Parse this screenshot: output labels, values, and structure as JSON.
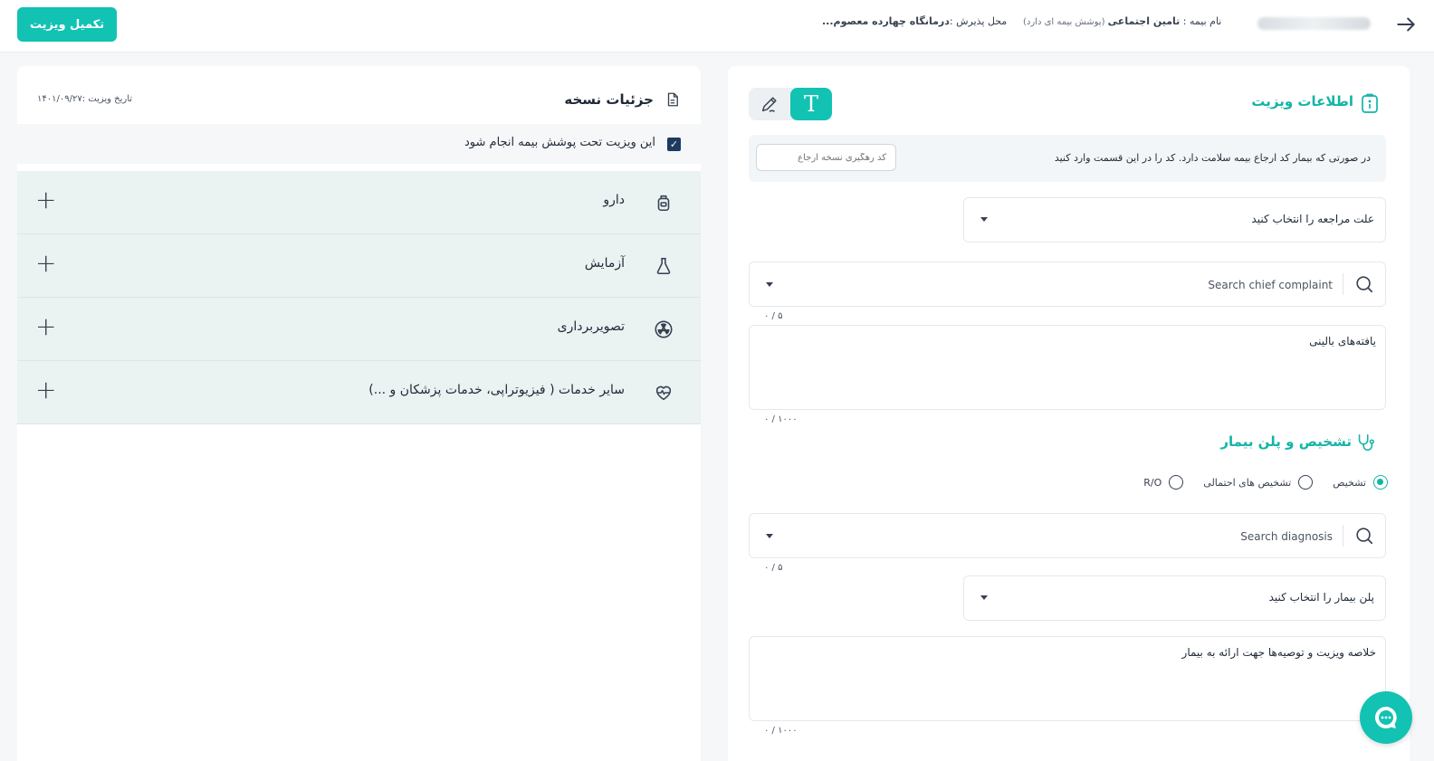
{
  "header": {
    "finish_label": "تکمیل ویزیت",
    "insurance_label": "نام بیمه : ",
    "insurance_name": "تامین اجتماعی",
    "insurance_note": " (پوشش بیمه ای دارد)",
    "reception_label": "محل پذیرش :",
    "reception_value": "درمانگاه چهارده معصوم..."
  },
  "prescription": {
    "title": "جزئیات نسخه",
    "visit_date": "تاریخ ویزیت :۱۴۰۱/۰۹/۲۷",
    "insurance_coverage_label": "این ویزیت تحت پوشش بیمه انجام شود",
    "insurance_coverage_checked": true,
    "services": [
      {
        "label": "دارو",
        "icon": "medicine-bottle-icon"
      },
      {
        "label": "آزمایش",
        "icon": "flask-icon"
      },
      {
        "label": "تصویربرداری",
        "icon": "radiation-icon"
      },
      {
        "label": "سایر خدمات ( فیزیوتراپی، خدمات پزشکان و ...)",
        "icon": "heart-pulse-icon"
      }
    ]
  },
  "visit_info": {
    "title": "اطلاعات ویزیت",
    "referral_text": "در صورتی که بیمار کد ارجاع بیمه سلامت دارد. کد را در این قسمت وارد کنید",
    "referral_placeholder": "کد رهگیری نسخه ارجاع",
    "visit_reason_placeholder": "علت مراجعه را انتخاب کنید",
    "chief_complaint_placeholder": "Search chief complaint",
    "chief_complaint_counter": "۰ / ۵",
    "clinical_findings_placeholder": "یافته‌های بالینی",
    "clinical_findings_counter": "۰ / ۱۰۰۰"
  },
  "diagnosis": {
    "title": "تشخیص و پلن بیمار",
    "options": [
      "تشخیص",
      "تشخیص های احتمالی",
      "R/O"
    ],
    "selected": "تشخیص",
    "search_placeholder": "Search diagnosis",
    "search_counter": "۰ / ۵",
    "plan_placeholder": "پلن بیمار را انتخاب کنید",
    "summary_placeholder": "خلاصه ویزیت و توصیه‌ها جهت ارائه به بیمار",
    "summary_counter": "۰ / ۱۰۰۰"
  },
  "colors": {
    "accent": "#12c2b3",
    "accent_text": "#12b5a7",
    "service_row_bg": "#eaf2f2",
    "checkbox": "#1e3a5f"
  }
}
